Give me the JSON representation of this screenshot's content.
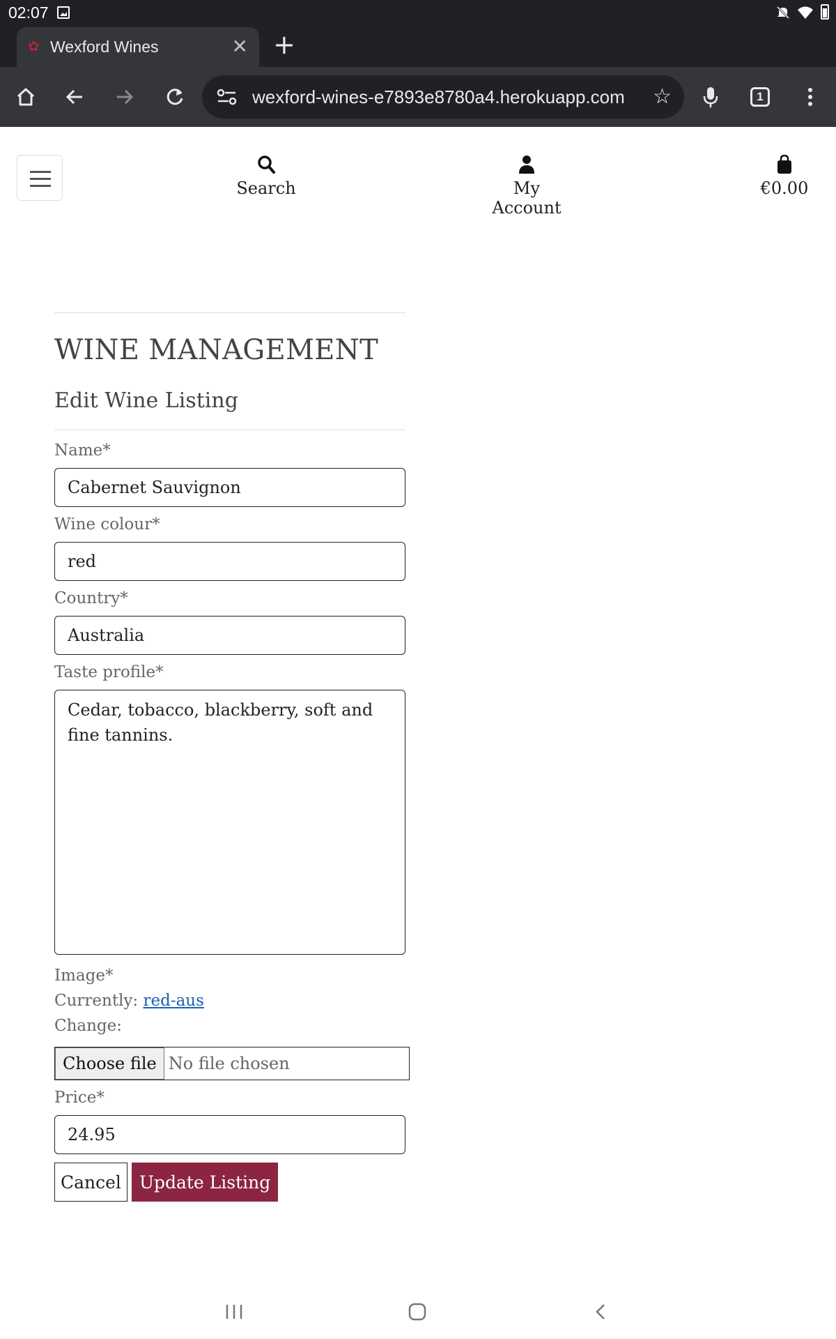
{
  "status_bar": {
    "time": "02:07"
  },
  "browser": {
    "tab_title": "Wexford Wines",
    "url": "wexford-wines-e7893e8780a4.herokuapp.com",
    "tab_count": "1"
  },
  "header": {
    "search_label": "Search",
    "account_label": "My Account",
    "bag_total": "€0.00"
  },
  "page": {
    "title": "WINE MANAGEMENT",
    "subtitle": "Edit Wine Listing"
  },
  "form": {
    "name_label": "Name*",
    "name_value": "Cabernet Sauvignon",
    "colour_label": "Wine colour*",
    "colour_value": "red",
    "country_label": "Country*",
    "country_value": "Australia",
    "taste_label": "Taste profile*",
    "taste_value": "Cedar, tobacco, blackberry, soft and fine tannins.",
    "image_label": "Image*",
    "currently_label": "Currently:",
    "current_image": "red-aus",
    "change_label": "Change:",
    "choose_file": "Choose file",
    "no_file": "No file chosen",
    "price_label": "Price*",
    "price_value": "24.95",
    "cancel_label": "Cancel",
    "update_label": "Update Listing"
  },
  "colors": {
    "accent": "#8b2541",
    "link": "#1a5fb4",
    "browser_dark": "#202124",
    "browser_toolbar": "#35363a"
  }
}
